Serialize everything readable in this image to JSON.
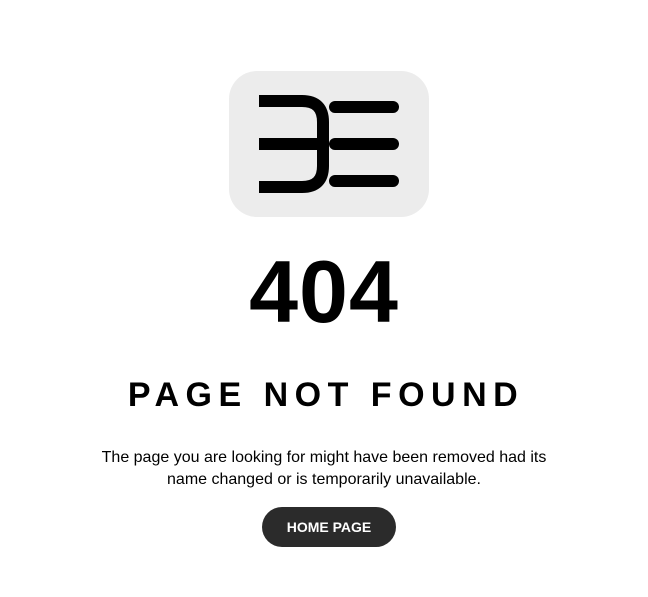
{
  "logo": {
    "icon": "brand-logo-mark",
    "background_color": "#ececec",
    "mark_color": "#000000"
  },
  "error": {
    "code": "404",
    "title": "PAGE NOT FOUND",
    "message_line_1": "The page you are looking for might have been removed had its",
    "message_line_2": "name changed or is temporarily unavailable."
  },
  "actions": {
    "home_label": "HOME PAGE",
    "button_color": "#2b2b2b"
  }
}
